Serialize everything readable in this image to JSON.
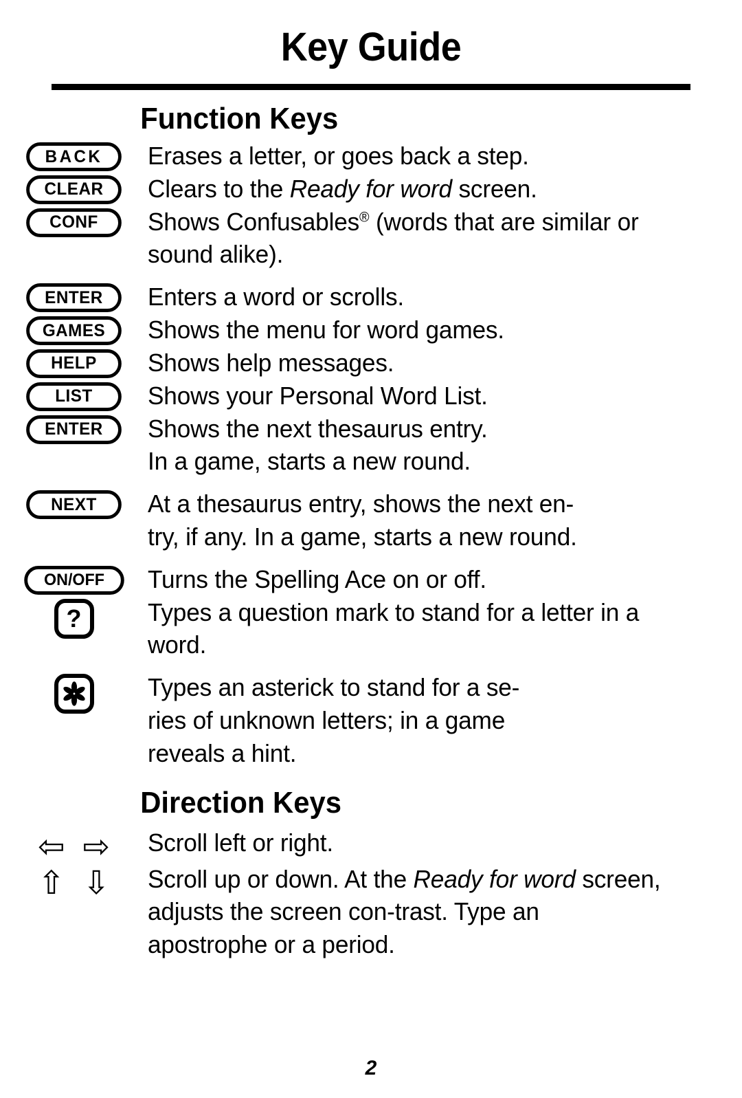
{
  "document": {
    "title": "Key Guide",
    "page_number": "2"
  },
  "sections": [
    {
      "heading": "Function Keys",
      "rows": [
        {
          "key": "BACK",
          "key_type": "pill",
          "desc": "Erases a letter, or goes back a step."
        },
        {
          "key": "CLEAR",
          "key_type": "pill",
          "desc": "Clears to the Ready for word screen."
        },
        {
          "key": "CONF",
          "key_type": "pill",
          "desc": "Shows Confusables® (words that are similar or sound alike)."
        },
        {
          "key": "ENTER",
          "key_type": "pill",
          "desc": "Enters a word or scrolls."
        },
        {
          "key": "GAMES",
          "key_type": "pill",
          "desc": "Shows the menu for word games."
        },
        {
          "key": "HELP",
          "key_type": "pill",
          "desc": "Shows help messages."
        },
        {
          "key": "LIST",
          "key_type": "pill",
          "desc": "Shows your Personal Word List."
        },
        {
          "key": "ENTER",
          "key_type": "pill",
          "desc": "Shows the next thesaurus entry. In a game, starts a new round."
        },
        {
          "key": "NEXT",
          "key_type": "pill",
          "desc": "At a thesaurus entry, shows the next en-try, if any. In a game, starts a new round."
        },
        {
          "key": "ON/OFF",
          "key_type": "pill",
          "desc": "Turns the Spelling Ace on or off."
        },
        {
          "key": "?",
          "key_type": "square",
          "desc": "Types a question mark to stand for a letter in a word."
        },
        {
          "key": "asterisk",
          "key_type": "square",
          "desc": "Types an asterick to stand for a se-ries of unknown letters; in a game reveals a hint."
        }
      ]
    },
    {
      "heading": "Direction Keys",
      "rows": [
        {
          "key": "left-right-arrows",
          "key_type": "arrows",
          "desc": "Scroll left or right."
        },
        {
          "key": "up-down-arrows",
          "key_type": "arrows",
          "desc": "Scroll up or down. At the Ready for word screen, adjusts the screen con-trast. Type an apostrophe or a period."
        }
      ]
    }
  ],
  "rows_fn": {
    "r0": {
      "key": "BACK",
      "d1": "Erases a letter, or goes back a step."
    },
    "r1": {
      "key": "CLEAR",
      "d1": "Clears to the ",
      "em": "Ready for word",
      "d2": " screen."
    },
    "r2": {
      "key": "CONF",
      "d1": "Shows Confusables",
      "sup": "®",
      "d2": " (words that are similar or sound alike)."
    },
    "r3": {
      "key": "ENTER",
      "d1": "Enters a word or scrolls."
    },
    "r4": {
      "key": "GAMES",
      "d1": "Shows the menu for word games."
    },
    "r5": {
      "key": "HELP",
      "d1": "Shows help messages."
    },
    "r6": {
      "key": "LIST",
      "d1": "Shows your Personal Word List."
    },
    "r7": {
      "key": "ENTER",
      "d1": "Shows the next thesaurus entry.",
      "d2": "In a game, starts a new round."
    },
    "r8": {
      "key": "NEXT",
      "d1": "At a thesaurus entry, shows the next en-",
      "d2": "try, if any. In a game, starts a new round."
    },
    "r9": {
      "key": "ON/OFF",
      "d1": "Turns the Spelling Ace on or off."
    },
    "r10": {
      "key": "?",
      "d1": "Types a question mark to stand for a letter in a word."
    },
    "r11": {
      "key": "*",
      "d1": "Types an asterick to stand for a se-",
      "d2": "ries of unknown letters; in a game",
      "d3": "reveals a hint."
    }
  },
  "rows_dir": {
    "r0": {
      "d1": "Scroll left or right."
    },
    "r1": {
      "d1": "Scroll up or down. At the ",
      "em1": "Ready for",
      "d2": " ",
      "em2": "word",
      "d3": " screen, adjusts the screen con-trast. Type an apostrophe or a period."
    }
  },
  "icons": {
    "arrow_left": "⇦",
    "arrow_right": "⇨",
    "arrow_up": "⇧",
    "arrow_down": "⇩"
  },
  "colors": {
    "ink": "#000000",
    "paper": "#ffffff"
  }
}
